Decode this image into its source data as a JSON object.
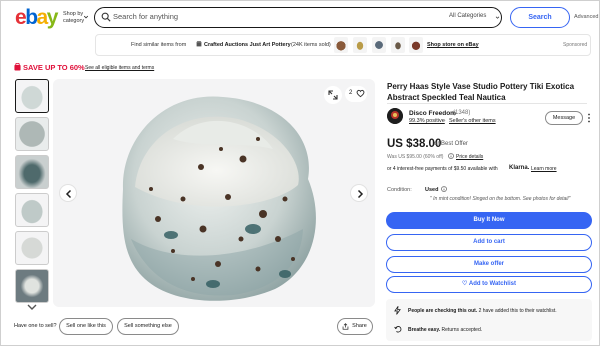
{
  "header": {
    "logo_letters": [
      "e",
      "b",
      "a",
      "y"
    ],
    "logo_colors": [
      "#e53238",
      "#0064d2",
      "#f5af02",
      "#86b817"
    ],
    "shop_by": "Shop by category",
    "search_placeholder": "Search for anything",
    "category": "All Categories",
    "search_button": "Search",
    "advanced": "Advanced"
  },
  "similar": {
    "text": "Find similar items from",
    "store": "Crafted Auctions Just Art Pottery",
    "sold": "(24K items sold)",
    "shop_link": "Shop store on eBay",
    "sponsored": "Sponsored"
  },
  "save_banner": {
    "text": "SAVE UP TO ",
    "percent": "60%",
    "link": "See all eligible items and terms"
  },
  "gallery": {
    "favorites": "2"
  },
  "actions_left": {
    "have_one": "Have one to sell?",
    "sell_one": "Sell one like this",
    "sell_something": "Sell something else",
    "share": "Share"
  },
  "listing": {
    "title": "Perry Haas Style Vase Studio Pottery Tiki Exotica Abstract Speckled Teal Nautica",
    "seller_name": "Disco Freedom",
    "seller_count": "(1348)",
    "seller_positive": "99.3% positive",
    "seller_sep": "·",
    "seller_other": "Seller's other items",
    "message": "Message",
    "price": "US $38.00",
    "best_offer": "or Best Offer",
    "was": "Was US $95.00 (60% off)",
    "price_details": "Price details",
    "klarna_text": "or 4 interest-free payments of $9.50 available with",
    "klarna_logo": "Klarna.",
    "learn_more": "Learn more",
    "condition_label": "Condition:",
    "condition_value": "Used",
    "condition_note": "\" In mint condition! Singed on the bottom. See photos for detail\"",
    "buy_now": "Buy It Now",
    "add_cart": "Add to cart",
    "make_offer": "Make offer",
    "watchlist": "♡ Add to Watchlist",
    "notice1_bold": "People are checking this out.",
    "notice1_rest": " 2 have added this to their watchlist.",
    "notice2_bold": "Breathe easy.",
    "notice2_rest": " Returns accepted."
  },
  "colors": {
    "accent": "#3665f3",
    "sale_red": "#e0103a"
  }
}
